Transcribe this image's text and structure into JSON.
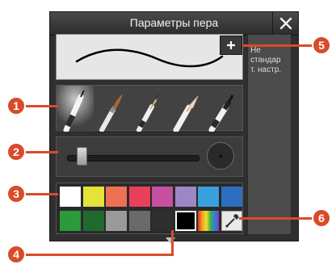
{
  "dialog": {
    "title": "Параметры пера",
    "close_label": "✕",
    "add_label": "+",
    "side_panel_lines": [
      "Не",
      "стандар",
      "т. настр."
    ]
  },
  "pens": [
    {
      "name": "pen",
      "selected": true
    },
    {
      "name": "brush",
      "selected": false
    },
    {
      "name": "pencil",
      "selected": false
    },
    {
      "name": "chisel-pen",
      "selected": false
    },
    {
      "name": "marker",
      "selected": false
    }
  ],
  "size_slider": {
    "value_fraction": 0.12
  },
  "palette": {
    "row1": [
      "#ffffff",
      "#e3e33a",
      "#f07055",
      "#e8405a",
      "#c64fa0",
      "#9d86c6",
      "#3aa0dd",
      "#2e6ec0"
    ],
    "row2": [
      "#2a9a3c",
      "#216a2e",
      "#9a9a9a",
      "#6a6a6a",
      "#2e2e2e",
      "#000000",
      "rainbow",
      "eyedropper"
    ],
    "selected": "#000000"
  },
  "callouts": [
    "1",
    "2",
    "3",
    "4",
    "5",
    "6"
  ],
  "colors": {
    "accent": "#d94b2b"
  }
}
